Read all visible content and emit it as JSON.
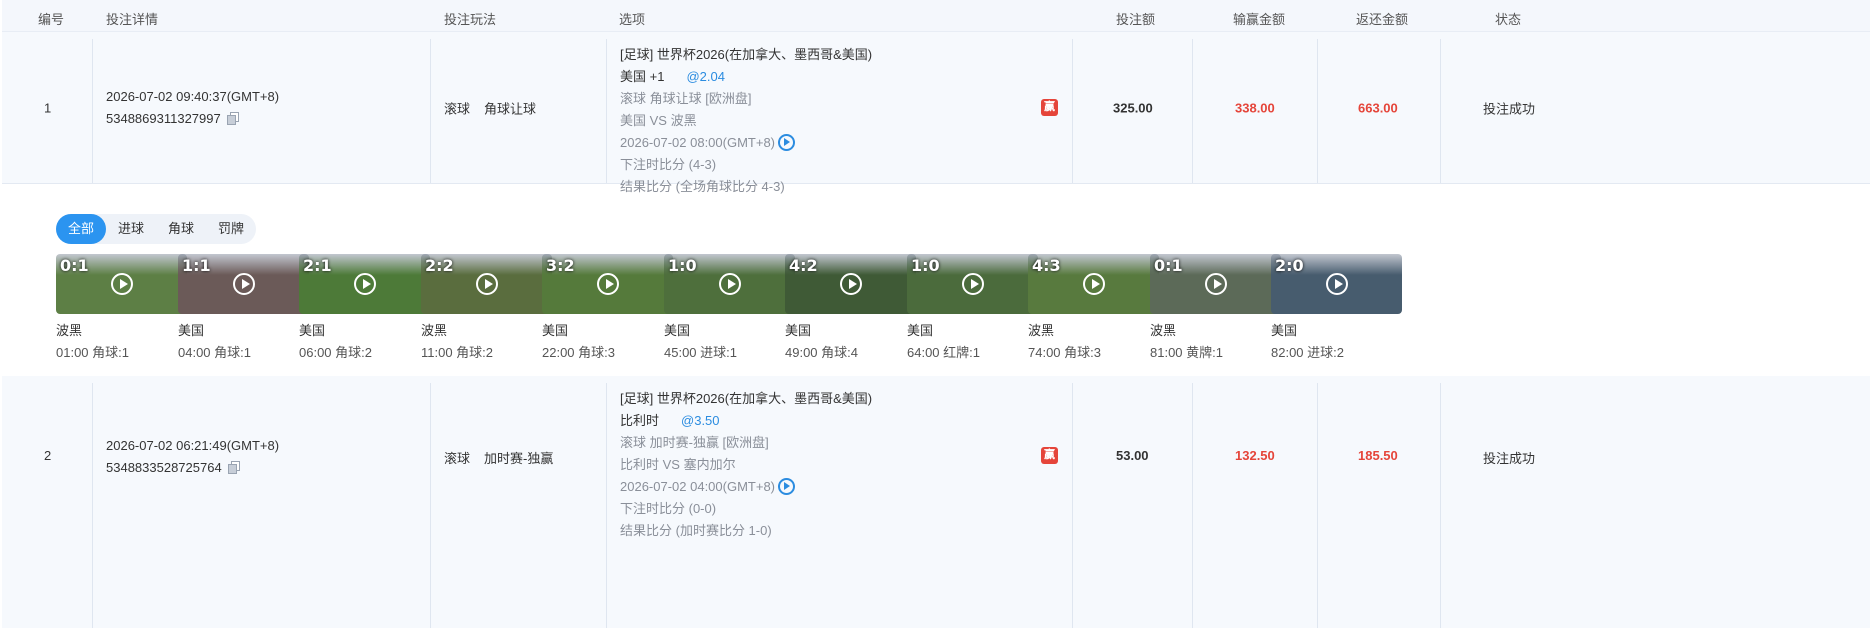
{
  "header": {
    "id": "编号",
    "detail": "投注详情",
    "play": "投注玩法",
    "option": "选项",
    "stake": "投注额",
    "winloss": "输赢金额",
    "return": "返还金额",
    "status": "状态"
  },
  "bets": [
    {
      "no": "1",
      "time": "2026-07-02 09:40:37(GMT+8)",
      "order_id": "5348869311327997",
      "play_type": "滚球",
      "play_name": "角球让球",
      "league": "[足球] 世界杯2026(在加拿大、墨西哥&美国)",
      "selection": "美国 +1",
      "odds": "@2.04",
      "market": "滚球 角球让球 [欧洲盘]",
      "match": "美国 VS 波黑",
      "match_time": "2026-07-02 08:00(GMT+8)",
      "bet_score": "下注时比分 (4-3)",
      "result_score": "结果比分 (全场角球比分 4-3)",
      "result_badge": "赢",
      "stake": "325.00",
      "winloss": "338.00",
      "return": "663.00",
      "status": "投注成功"
    },
    {
      "no": "2",
      "time": "2026-07-02 06:21:49(GMT+8)",
      "order_id": "5348833528725764",
      "play_type": "滚球",
      "play_name": "加时赛-独赢",
      "league": "[足球] 世界杯2026(在加拿大、墨西哥&美国)",
      "selection": "比利时",
      "odds": "@3.50",
      "market": "滚球 加时赛-独赢 [欧洲盘]",
      "match": "比利时 VS 塞内加尔",
      "match_time": "2026-07-02 04:00(GMT+8)",
      "bet_score": "下注时比分 (0-0)",
      "result_score": "结果比分 (加时赛比分 1-0)",
      "result_badge": "赢",
      "stake": "53.00",
      "winloss": "132.50",
      "return": "185.50",
      "status": "投注成功"
    }
  ],
  "filters": [
    "全部",
    "进球",
    "角球",
    "罚牌"
  ],
  "active_filter": "全部",
  "clips": [
    {
      "score": "0:1",
      "team": "波黑",
      "event": "01:00 角球:1",
      "color": "#5d7f45"
    },
    {
      "score": "1:1",
      "team": "美国",
      "event": "04:00 角球:1",
      "color": "#6b5a58"
    },
    {
      "score": "2:1",
      "team": "美国",
      "event": "06:00 角球:2",
      "color": "#4d7a38"
    },
    {
      "score": "2:2",
      "team": "波黑",
      "event": "11:00 角球:2",
      "color": "#5a6d3e"
    },
    {
      "score": "3:2",
      "team": "美国",
      "event": "22:00 角球:3",
      "color": "#557a3b"
    },
    {
      "score": "1:0",
      "team": "美国",
      "event": "45:00 进球:1",
      "color": "#4e6f3c"
    },
    {
      "score": "4:2",
      "team": "美国",
      "event": "49:00 角球:4",
      "color": "#3f5a36"
    },
    {
      "score": "1:0",
      "team": "美国",
      "event": "64:00 红牌:1",
      "color": "#4b6b3c"
    },
    {
      "score": "4:3",
      "team": "波黑",
      "event": "74:00 角球:3",
      "color": "#587a3e"
    },
    {
      "score": "0:1",
      "team": "波黑",
      "event": "81:00 黄牌:1",
      "color": "#5c6a58"
    },
    {
      "score": "2:0",
      "team": "美国",
      "event": "82:00 进球:2",
      "color": "#475c6e"
    }
  ]
}
